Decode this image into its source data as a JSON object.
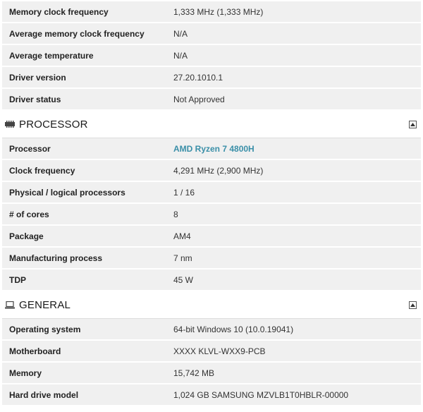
{
  "gpu_rows": [
    {
      "label": "Memory clock frequency",
      "value": "1,333 MHz (1,333 MHz)"
    },
    {
      "label": "Average memory clock frequency",
      "value": "N/A"
    },
    {
      "label": "Average temperature",
      "value": "N/A"
    },
    {
      "label": "Driver version",
      "value": "27.20.1010.1"
    },
    {
      "label": "Driver status",
      "value": "Not Approved"
    }
  ],
  "processor": {
    "title": "PROCESSOR",
    "icon": "processor-icon",
    "rows": [
      {
        "label": "Processor",
        "value": "AMD Ryzen 7 4800H"
      },
      {
        "label": "Clock frequency",
        "value": "4,291 MHz (2,900 MHz)"
      },
      {
        "label": "Physical / logical processors",
        "value": "1 / 16"
      },
      {
        "label": "# of cores",
        "value": "8"
      },
      {
        "label": "Package",
        "value": "AM4"
      },
      {
        "label": "Manufacturing process",
        "value": "7 nm"
      },
      {
        "label": "TDP",
        "value": "45 W"
      }
    ]
  },
  "general": {
    "title": "GENERAL",
    "icon": "laptop-icon",
    "rows": [
      {
        "label": "Operating system",
        "value": "64-bit Windows 10 (10.0.19041)"
      },
      {
        "label": "Motherboard",
        "value": "XXXX KLVL-WXX9-PCB"
      },
      {
        "label": "Memory",
        "value": "15,742 MB"
      },
      {
        "label": "Hard drive model",
        "value": "1,024 GB SAMSUNG MZVLB1T0HBLR-00000"
      }
    ]
  },
  "colors": {
    "link": "#3a8fa8",
    "row_bg": "#f0f0f0"
  }
}
